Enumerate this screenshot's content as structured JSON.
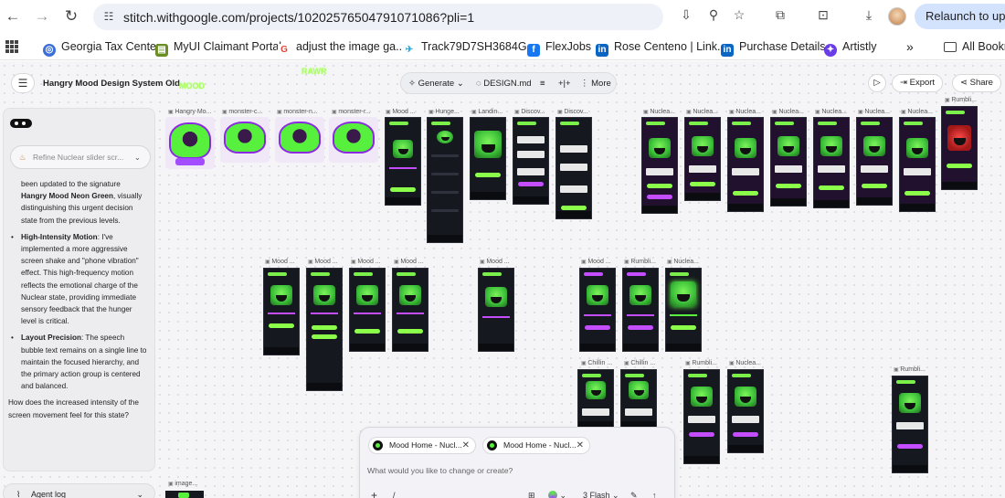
{
  "browser": {
    "url": "stitch.withgoogle.com/projects/10202576504791071086?pli=1",
    "relaunch_label": "Relaunch to update"
  },
  "bookmarks": [
    {
      "label": "Georgia Tax Center",
      "icon": "globe-icon",
      "color": "#3c6fd8"
    },
    {
      "label": "MyUI Claimant Portal",
      "icon": "portal-icon",
      "color": "#6b8e23"
    },
    {
      "label": "adjust the image ga...",
      "icon": "google-icon",
      "color": "#ea4335"
    },
    {
      "label": "Track79D7SH3684G...",
      "icon": "plane-icon",
      "color": "#2aa7e0"
    },
    {
      "label": "FlexJobs",
      "icon": "facebook-icon",
      "color": "#1877f2"
    },
    {
      "label": "Rose Centeno | Link...",
      "icon": "linkedin-icon",
      "color": "#0a66c2"
    },
    {
      "label": "Purchase Details",
      "icon": "linkedin-icon",
      "color": "#0a66c2"
    },
    {
      "label": "Artistly",
      "icon": "artistly-icon",
      "color": "#6a3de8"
    }
  ],
  "bookmarks_overflow": "»",
  "all_bookmarks_label": "All Bookm",
  "app": {
    "project_title": "Hangry Mood Design System Old",
    "logo_text_1": "MOOD",
    "logo_text_2": "RAWR",
    "toolbar": {
      "generate_label": "Generate",
      "design_md_label": "DESIGN.md",
      "more_label": "More",
      "export_label": "Export",
      "share_label": "Share"
    }
  },
  "chat": {
    "refine_placeholder": "Refine Nuclear slider scr...",
    "intro_lead": "been updated to the signature ",
    "intro_bold": "Hangry Mood Neon Green",
    "intro_rest": ", visually distinguishing this urgent decision state from the previous levels.",
    "bullet1_title": "High-Intensity Motion",
    "bullet1_text": ": I've implemented a more aggressive screen shake and \"phone vibration\" effect. This high-frequency motion reflects the emotional charge of the Nuclear state, providing immediate sensory feedback that the hunger level is critical.",
    "bullet2_title": "Layout Precision",
    "bullet2_text": ": The speech bubble text remains on a single line to maintain the focused hierarchy, and the primary action group is centered and balanced.",
    "question": "How does the increased intensity of the screen movement feel for this state?",
    "agent_log_label": "Agent log"
  },
  "canvas": {
    "labels": {
      "hangry_mo": "Hangry Mo...",
      "monster_c": "monster-c...",
      "monster_n": "monster-n...",
      "monster_r": "monster-r...",
      "mood": "Mood ...",
      "hunge": "Hunge...",
      "landin": "Landin...",
      "discov": "Discov...",
      "nuclea": "Nuclea...",
      "rumbli": "Rumbli...",
      "chillin": "Chillin ...",
      "image": "image..."
    }
  },
  "prompt": {
    "tab1": "Mood Home - Nucl...",
    "tab2": "Mood Home - Nucl...",
    "placeholder": "What would you like to change or create?",
    "plus": "+",
    "slash": "/",
    "model_label": "3 Flash"
  }
}
